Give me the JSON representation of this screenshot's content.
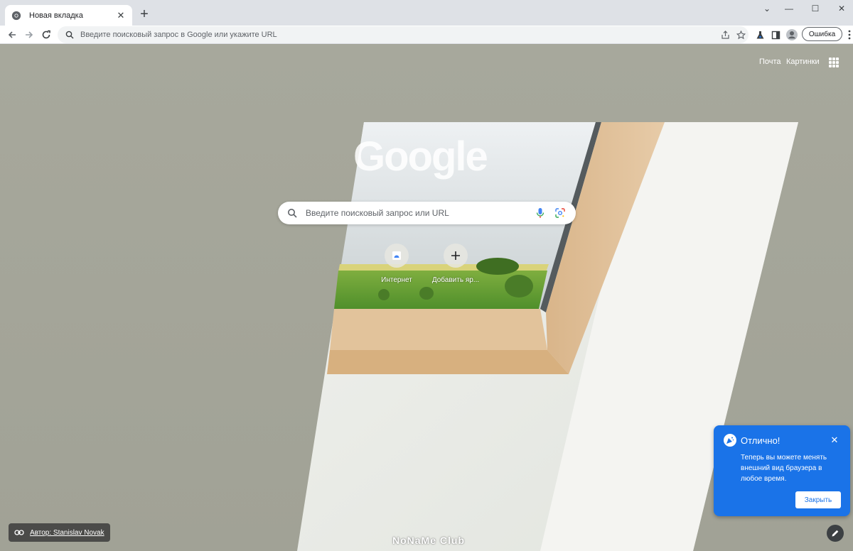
{
  "tab": {
    "title": "Новая вкладка",
    "close": "✕"
  },
  "new_tab_glyph": "+",
  "window": {
    "minimize": "—",
    "maximize": "☐",
    "close": "✕",
    "dropdown": "⌄"
  },
  "omnibox": {
    "placeholder": "Введите поисковый запрос в Google или укажите URL"
  },
  "profile": {
    "error_label": "Ошибка"
  },
  "ntp": {
    "links": {
      "mail": "Почта",
      "images": "Картинки"
    },
    "logo": "Google",
    "search": {
      "placeholder": "Введите поисковый запрос или URL"
    },
    "shortcuts": [
      {
        "label": "Интернет"
      },
      {
        "label": "Добавить яр..."
      }
    ],
    "author": "Автор: Stanislav Novak",
    "watermark": "NoNaMe Club"
  },
  "bubble": {
    "title": "Отлично!",
    "body": "Теперь вы можете менять внешний вид браузера в любое время.",
    "button": "Закрыть",
    "close": "✕"
  },
  "colors": {
    "accent": "#1a73e8",
    "tabstrip": "#dee1e6"
  }
}
